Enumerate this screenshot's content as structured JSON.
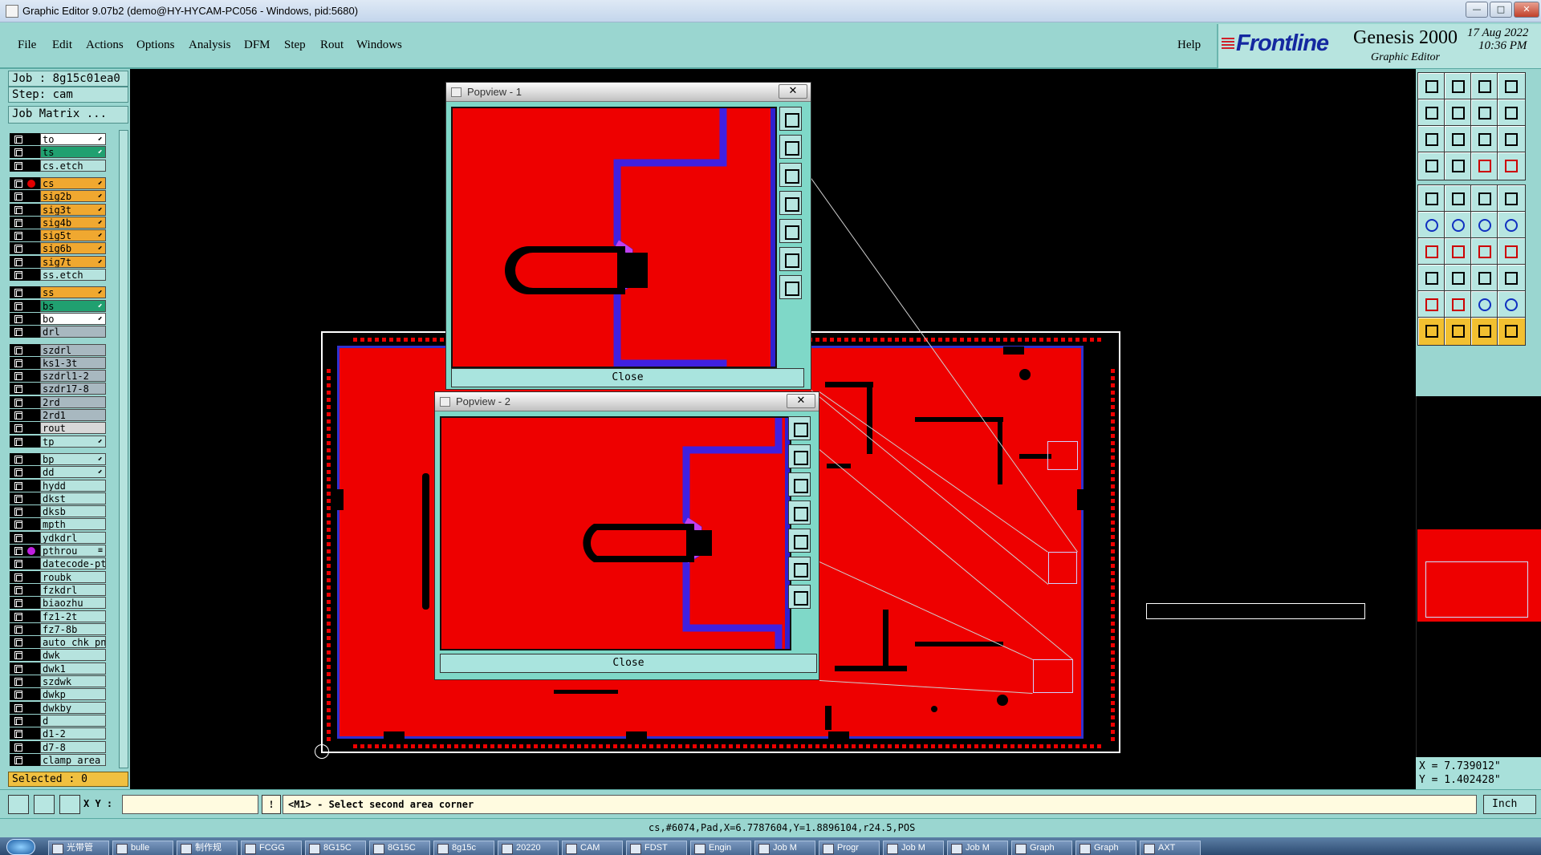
{
  "window": {
    "title": "Graphic Editor 9.07b2 (demo@HY-HYCAM-PC056 - Windows, pid:5680)"
  },
  "menu": {
    "items": [
      "File",
      "Edit",
      "Actions",
      "Options",
      "Analysis",
      "DFM",
      "Step",
      "Rout",
      "Windows"
    ],
    "help": "Help"
  },
  "brand": {
    "company": "Frontline",
    "product": "Genesis 2000",
    "subtitle": "Graphic Editor",
    "date": "17 Aug 2022",
    "time": "10:36 PM"
  },
  "job": {
    "job": "Job : 8g15c01ea0",
    "step": "Step: cam",
    "matrix_button": "Job Matrix ..."
  },
  "layers": [
    {
      "name": "to",
      "color": "#ffffff",
      "dot": "",
      "sig": "⬋"
    },
    {
      "name": "ts",
      "color": "#20a070",
      "dot": "",
      "sig": "⬋"
    },
    {
      "name": "cs.etch",
      "color": "#b6e3de",
      "dot": "",
      "sig": ""
    },
    {
      "name": "cs",
      "color": "#f0a830",
      "dot": "#e00000",
      "sig": "⬋"
    },
    {
      "name": "sig2b",
      "color": "#f0a830",
      "dot": "",
      "sig": "⬋"
    },
    {
      "name": "sig3t",
      "color": "#f0a830",
      "dot": "",
      "sig": "⬋"
    },
    {
      "name": "sig4b",
      "color": "#f0a830",
      "dot": "",
      "sig": "⬋"
    },
    {
      "name": "sig5t",
      "color": "#f0a830",
      "dot": "",
      "sig": "⬋"
    },
    {
      "name": "sig6b",
      "color": "#f0a830",
      "dot": "",
      "sig": "⬋"
    },
    {
      "name": "sig7t",
      "color": "#f0a830",
      "dot": "",
      "sig": "⬋"
    },
    {
      "name": "ss.etch",
      "color": "#b6e3de",
      "dot": "",
      "sig": ""
    },
    {
      "name": "ss",
      "color": "#f0a830",
      "dot": "",
      "sig": "⬋"
    },
    {
      "name": "bs",
      "color": "#20a070",
      "dot": "",
      "sig": "⬋"
    },
    {
      "name": "bo",
      "color": "#ffffff",
      "dot": "",
      "sig": "⬋"
    },
    {
      "name": "drl",
      "color": "#a8b8c0",
      "dot": "",
      "sig": ""
    },
    {
      "name": "szdrl",
      "color": "#a8b8c0",
      "dot": "",
      "sig": ""
    },
    {
      "name": "ks1-3t",
      "color": "#a8b8c0",
      "dot": "",
      "sig": ""
    },
    {
      "name": "szdrl1-2",
      "color": "#a8b8c0",
      "dot": "",
      "sig": ""
    },
    {
      "name": "szdr17-8",
      "color": "#a8b8c0",
      "dot": "",
      "sig": ""
    },
    {
      "name": "2rd",
      "color": "#a8b8c0",
      "dot": "",
      "sig": ""
    },
    {
      "name": "2rd1",
      "color": "#a8b8c0",
      "dot": "",
      "sig": ""
    },
    {
      "name": "rout",
      "color": "#d8d8d8",
      "dot": "",
      "sig": ""
    },
    {
      "name": "tp",
      "color": "#b6e3de",
      "dot": "",
      "sig": "⬋"
    },
    {
      "name": "bp",
      "color": "#b6e3de",
      "dot": "",
      "sig": "⬋"
    },
    {
      "name": "dd",
      "color": "#b6e3de",
      "dot": "",
      "sig": "⬋"
    },
    {
      "name": "hydd",
      "color": "#b6e3de",
      "dot": "",
      "sig": ""
    },
    {
      "name": "dkst",
      "color": "#b6e3de",
      "dot": "",
      "sig": ""
    },
    {
      "name": "dksb",
      "color": "#b6e3de",
      "dot": "",
      "sig": ""
    },
    {
      "name": "mpth",
      "color": "#b6e3de",
      "dot": "",
      "sig": ""
    },
    {
      "name": "ydkdrl",
      "color": "#b6e3de",
      "dot": "",
      "sig": ""
    },
    {
      "name": "pthrou",
      "color": "#b6e3de",
      "dot": "#c020e0",
      "sig": "≡"
    },
    {
      "name": "datecode-pt",
      "color": "#b6e3de",
      "dot": "",
      "sig": ""
    },
    {
      "name": "roubk",
      "color": "#b6e3de",
      "dot": "",
      "sig": ""
    },
    {
      "name": "fzkdrl",
      "color": "#b6e3de",
      "dot": "",
      "sig": ""
    },
    {
      "name": "biaozhu",
      "color": "#b6e3de",
      "dot": "",
      "sig": ""
    },
    {
      "name": "fz1-2t",
      "color": "#b6e3de",
      "dot": "",
      "sig": ""
    },
    {
      "name": "fz7-8b",
      "color": "#b6e3de",
      "dot": "",
      "sig": ""
    },
    {
      "name": "auto_chk_pn",
      "color": "#b6e3de",
      "dot": "",
      "sig": ""
    },
    {
      "name": "dwk",
      "color": "#b6e3de",
      "dot": "",
      "sig": ""
    },
    {
      "name": "dwk1",
      "color": "#b6e3de",
      "dot": "",
      "sig": ""
    },
    {
      "name": "szdwk",
      "color": "#b6e3de",
      "dot": "",
      "sig": ""
    },
    {
      "name": "dwkp",
      "color": "#b6e3de",
      "dot": "",
      "sig": ""
    },
    {
      "name": "dwkby",
      "color": "#b6e3de",
      "dot": "",
      "sig": ""
    },
    {
      "name": "d",
      "color": "#b6e3de",
      "dot": "",
      "sig": ""
    },
    {
      "name": "d1-2",
      "color": "#b6e3de",
      "dot": "",
      "sig": ""
    },
    {
      "name": "d7-8",
      "color": "#b6e3de",
      "dot": "",
      "sig": ""
    },
    {
      "name": "clamp_area",
      "color": "#b6e3de",
      "dot": "",
      "sig": ""
    }
  ],
  "selected": "Selected : 0",
  "popviews": [
    {
      "title": "Popview - 1",
      "close_label": "Close",
      "x_label": "✕"
    },
    {
      "title": "Popview - 2",
      "close_label": "Close",
      "x_label": "✕"
    }
  ],
  "coords": {
    "x": "X = 7.739012\"",
    "y": "Y = 1.402428\""
  },
  "command": {
    "xy_label": "X Y :",
    "xy_value": "",
    "prompt": "<M1> - Select second area corner",
    "units": "Inch"
  },
  "status_line": "cs,#6074,Pad,X=6.7787604,Y=1.8896104,r24.5,POS",
  "taskbar": [
    "光带管",
    "bulle",
    "制作规",
    "FCGG",
    "8G15C",
    "8G15C",
    "8g15c",
    "20220",
    "CAM",
    "FDST",
    "Engin",
    "Job M",
    "Progr",
    "Job M",
    "Job M",
    "Graph",
    "Graph",
    "AXT"
  ],
  "colors": {
    "accent": "#9ad6d0",
    "copper": "#ee0000",
    "outline": "#3030d0",
    "selected": "#f0c040"
  }
}
